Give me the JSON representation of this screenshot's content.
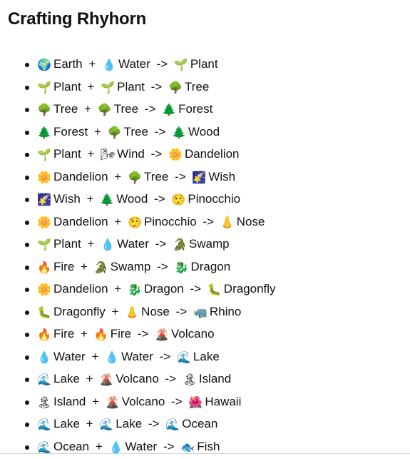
{
  "title": "Crafting Rhyhorn",
  "recipes": [
    {
      "a_icon": "🌍",
      "a": "Earth",
      "b_icon": "💧",
      "b": "Water",
      "r_icon": "🌱",
      "r": "Plant"
    },
    {
      "a_icon": "🌱",
      "a": "Plant",
      "b_icon": "🌱",
      "b": "Plant",
      "r_icon": "🌳",
      "r": "Tree"
    },
    {
      "a_icon": "🌳",
      "a": "Tree",
      "b_icon": "🌳",
      "b": "Tree",
      "r_icon": "🌲",
      "r": "Forest"
    },
    {
      "a_icon": "🌲",
      "a": "Forest",
      "b_icon": "🌳",
      "b": "Tree",
      "r_icon": "🌲",
      "r": "Wood"
    },
    {
      "a_icon": "🌱",
      "a": "Plant",
      "b_icon": "🌬",
      "b": "Wind",
      "r_icon": "🌼",
      "r": "Dandelion"
    },
    {
      "a_icon": "🌼",
      "a": "Dandelion",
      "b_icon": "🌳",
      "b": "Tree",
      "r_icon": "🌠",
      "r": "Wish"
    },
    {
      "a_icon": "🌠",
      "a": "Wish",
      "b_icon": "🌲",
      "b": "Wood",
      "r_icon": "🤥",
      "r": "Pinocchio"
    },
    {
      "a_icon": "🌼",
      "a": "Dandelion",
      "b_icon": "🤥",
      "b": "Pinocchio",
      "r_icon": "👃",
      "r": "Nose"
    },
    {
      "a_icon": "🌱",
      "a": "Plant",
      "b_icon": "💧",
      "b": "Water",
      "r_icon": "🐊",
      "r": "Swamp"
    },
    {
      "a_icon": "🔥",
      "a": "Fire",
      "b_icon": "🐊",
      "b": "Swamp",
      "r_icon": "🐉",
      "r": "Dragon"
    },
    {
      "a_icon": "🌼",
      "a": "Dandelion",
      "b_icon": "🐉",
      "b": "Dragon",
      "r_icon": "🐛",
      "r": "Dragonfly"
    },
    {
      "a_icon": "🐛",
      "a": "Dragonfly",
      "b_icon": "👃",
      "b": "Nose",
      "r_icon": "🦏",
      "r": "Rhino"
    },
    {
      "a_icon": "🔥",
      "a": "Fire",
      "b_icon": "🔥",
      "b": "Fire",
      "r_icon": "🌋",
      "r": "Volcano"
    },
    {
      "a_icon": "💧",
      "a": "Water",
      "b_icon": "💧",
      "b": "Water",
      "r_icon": "🌊",
      "r": "Lake"
    },
    {
      "a_icon": "🌊",
      "a": "Lake",
      "b_icon": "🌋",
      "b": "Volcano",
      "r_icon": "🏝",
      "r": "Island"
    },
    {
      "a_icon": "🏝",
      "a": "Island",
      "b_icon": "🌋",
      "b": "Volcano",
      "r_icon": "🌺",
      "r": "Hawaii"
    },
    {
      "a_icon": "🌊",
      "a": "Lake",
      "b_icon": "🌊",
      "b": "Lake",
      "r_icon": "🌊",
      "r": "Ocean"
    },
    {
      "a_icon": "🌊",
      "a": "Ocean",
      "b_icon": "💧",
      "b": "Water",
      "r_icon": "🐟",
      "r": "Fish"
    }
  ],
  "icon_names": {
    "🌍": "earth-globe-icon",
    "💧": "water-droplet-icon",
    "🌱": "seedling-icon",
    "🌳": "deciduous-tree-icon",
    "🌲": "evergreen-tree-icon",
    "🌬": "wind-face-icon",
    "🌼": "blossom-icon",
    "🌠": "shooting-star-icon",
    "🤥": "lying-face-icon",
    "👃": "nose-icon",
    "🐊": "crocodile-icon",
    "🔥": "fire-icon",
    "🐉": "dragon-icon",
    "🐛": "bug-caterpillar-icon",
    "🦏": "rhinoceros-icon",
    "🌋": "volcano-icon",
    "🌊": "water-wave-icon",
    "🏝": "desert-island-icon",
    "🌺": "hibiscus-icon",
    "🐟": "fish-icon"
  },
  "operators": {
    "plus": "+",
    "arrow": "->"
  }
}
